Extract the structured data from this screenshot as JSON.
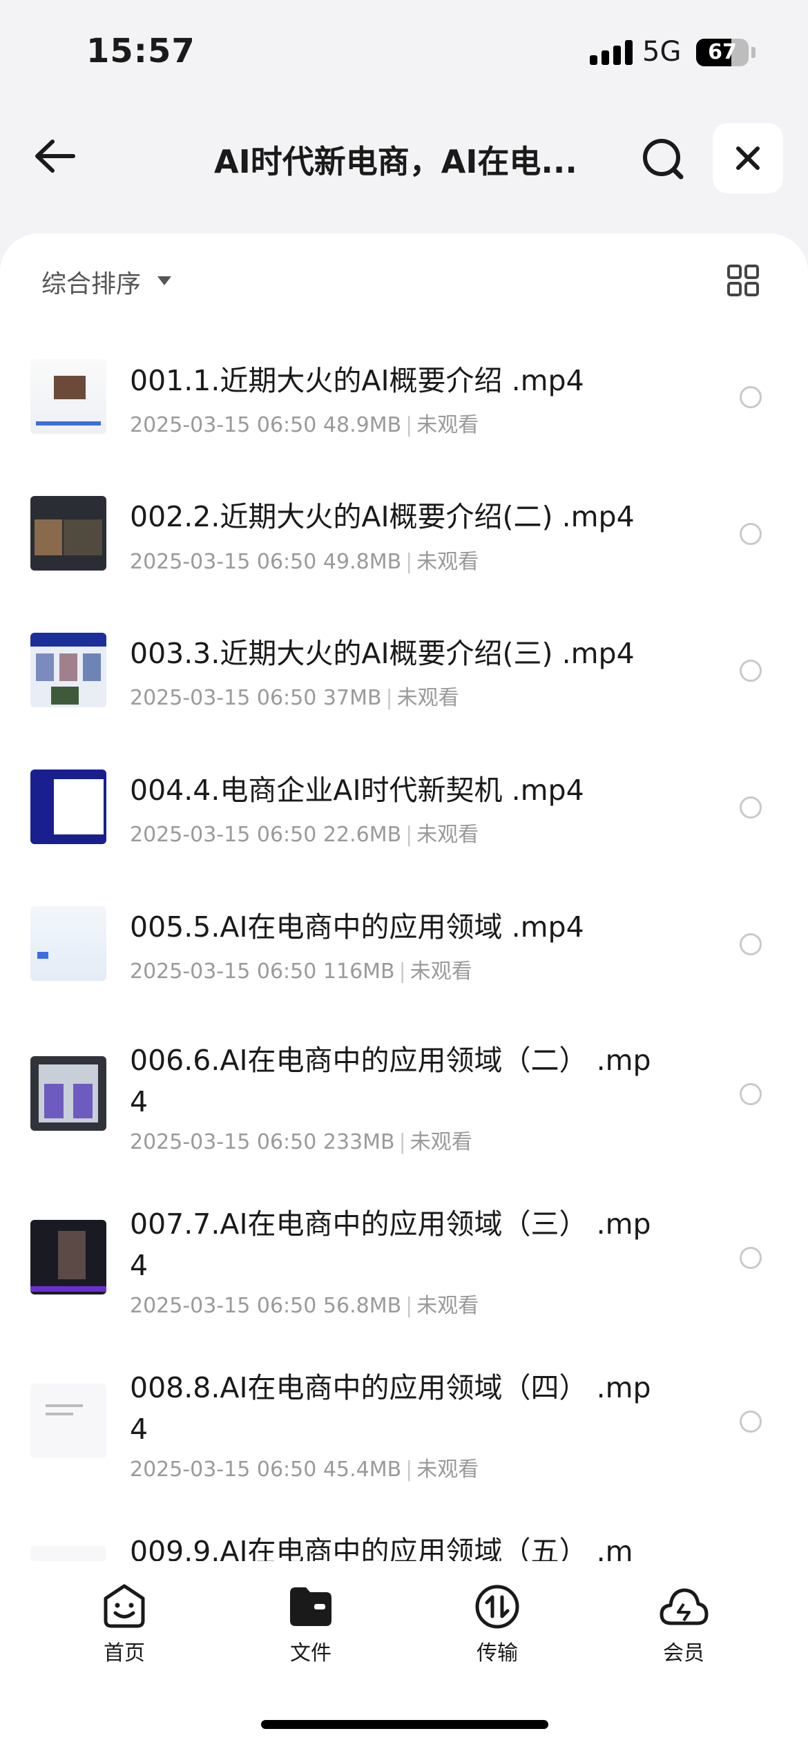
{
  "status": {
    "time": "15:57",
    "network": "5G",
    "battery": "67",
    "battery_level": 0.67
  },
  "nav": {
    "title": "AI时代新电商，AI在电..."
  },
  "toolbar": {
    "sort_label": "综合排序"
  },
  "files": [
    {
      "name": "001.1.近期大火的AI概要介绍 .mp4",
      "date": "2025-03-15 06:50",
      "size": "48.9MB",
      "status": "未观看"
    },
    {
      "name": "002.2.近期大火的AI概要介绍(二) .mp4",
      "date": "2025-03-15 06:50",
      "size": "49.8MB",
      "status": "未观看"
    },
    {
      "name": "003.3.近期大火的AI概要介绍(三) .mp4",
      "date": "2025-03-15 06:50",
      "size": "37MB",
      "status": "未观看"
    },
    {
      "name": "004.4.电商企业AI时代新契机 .mp4",
      "date": "2025-03-15 06:50",
      "size": "22.6MB",
      "status": "未观看"
    },
    {
      "name": "005.5.AI在电商中的应用领域 .mp4",
      "date": "2025-03-15 06:50",
      "size": "116MB",
      "status": "未观看"
    },
    {
      "name": "006.6.AI在电商中的应用领域（二） .mp4",
      "date": "2025-03-15 06:50",
      "size": "233MB",
      "status": "未观看"
    },
    {
      "name": "007.7.AI在电商中的应用领域（三） .mp4",
      "date": "2025-03-15 06:50",
      "size": "56.8MB",
      "status": "未观看"
    },
    {
      "name": "008.8.AI在电商中的应用领域（四） .mp4",
      "date": "2025-03-15 06:50",
      "size": "45.4MB",
      "status": "未观看"
    },
    {
      "name": "009.9.AI在电商中的应用领域（五） .m",
      "date": "",
      "size": "",
      "status": ""
    }
  ],
  "tabs": [
    {
      "label": "首页",
      "icon": "smile-face-icon"
    },
    {
      "label": "文件",
      "icon": "folder-icon"
    },
    {
      "label": "传输",
      "icon": "transfer-icon"
    },
    {
      "label": "会员",
      "icon": "cloud-icon"
    }
  ]
}
